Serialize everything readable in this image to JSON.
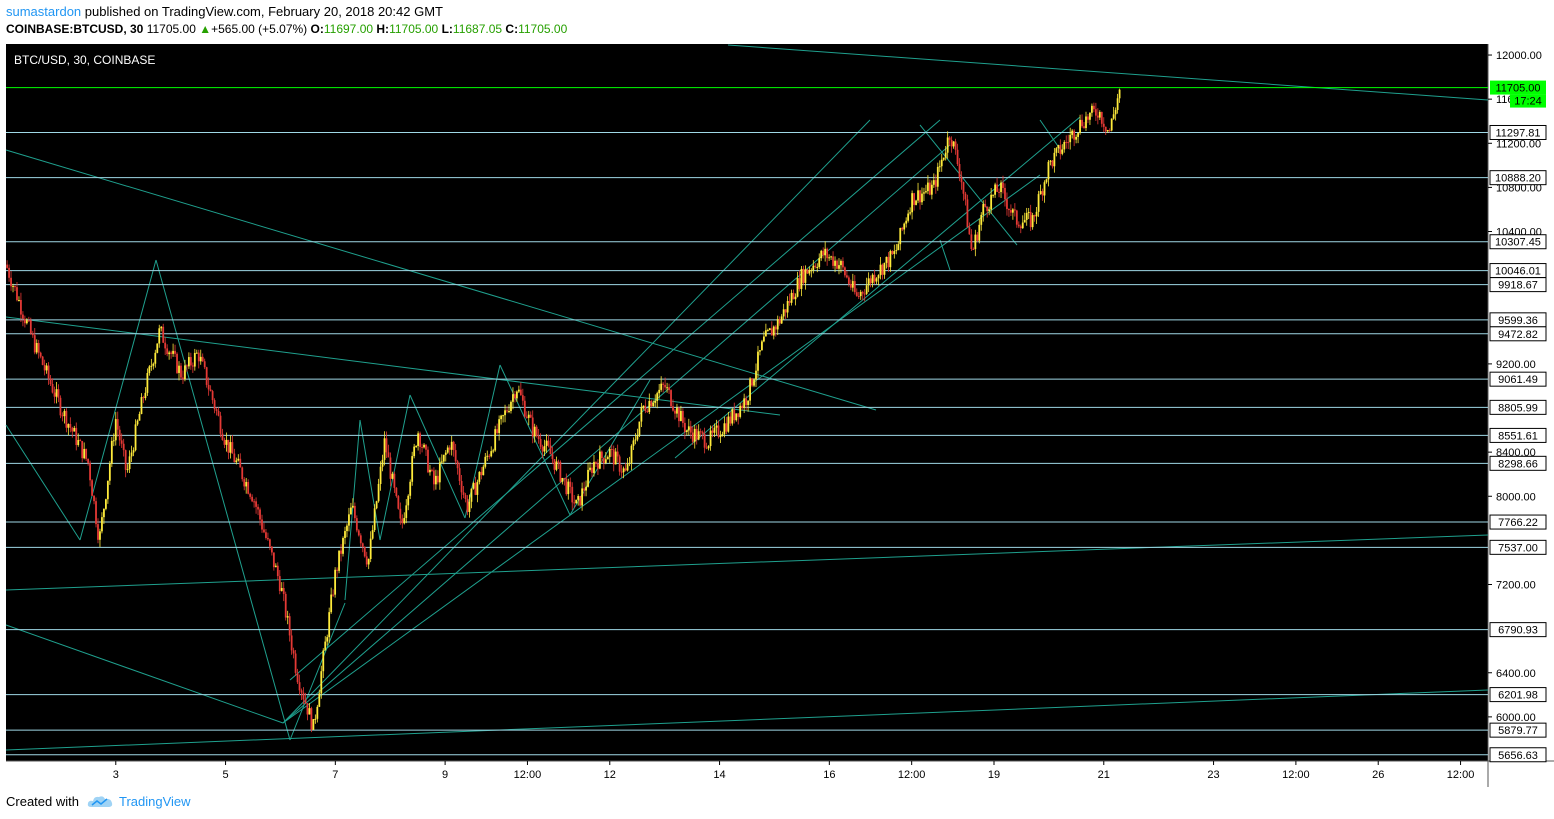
{
  "header": {
    "user": "sumastardon",
    "published_text": "published on TradingView.com, February 20, 2018 20:42 GMT",
    "symbol": "COINBASE:BTCUSD, 30",
    "last": "11705.00",
    "change": "+565.00 (+5.07%)",
    "o_label": "O:",
    "o_value": "11697.00",
    "h_label": "H:",
    "h_value": "11705.00",
    "l_label": "L:",
    "l_value": "11687.05",
    "c_label": "C:",
    "c_value": "11705.00"
  },
  "footer": {
    "created_with": "Created with",
    "brand": "TradingView"
  },
  "colors": {
    "background": "#000000",
    "level_line": "#9fd8e6",
    "trend_line": "#1fa08e",
    "last_price": "#00ff00",
    "candle_up": "#ffeb3b",
    "candle_down": "#e53935"
  },
  "chart_data": {
    "type": "candlestick",
    "title": "BTC/USD, 30, COINBASE",
    "ylim": [
      5600,
      12100
    ],
    "y_ticks": [
      12000,
      11600,
      11200,
      10800,
      10400,
      9200,
      8400,
      8000,
      7200,
      6400,
      6000
    ],
    "x_ticks": [
      "3",
      "5",
      "7",
      "9",
      "12:00",
      "12",
      "14",
      "16",
      "12:00",
      "19",
      "21",
      "23",
      "12:00",
      "26",
      "12:00"
    ],
    "x_tick_days": [
      3,
      5,
      7,
      9,
      10.5,
      12,
      14,
      16,
      17.5,
      19,
      21,
      23,
      24.5,
      26,
      27.5
    ],
    "xlim_days": [
      1.0,
      28.0
    ],
    "horizontal_levels": [
      11297.81,
      10888.2,
      10307.45,
      10046.01,
      9918.67,
      9599.36,
      9472.82,
      9061.49,
      8805.99,
      8551.61,
      8298.66,
      7766.22,
      7537.0,
      6790.93,
      6201.98,
      5879.77,
      5656.63
    ],
    "last_price": {
      "value": "11705.00",
      "timer": "17:24"
    },
    "price_path": [
      [
        1.0,
        10100
      ],
      [
        1.5,
        9400
      ],
      [
        2.0,
        8800
      ],
      [
        2.5,
        8300
      ],
      [
        2.7,
        7600
      ],
      [
        3.0,
        8700
      ],
      [
        3.2,
        8200
      ],
      [
        3.5,
        8900
      ],
      [
        3.8,
        9500
      ],
      [
        4.2,
        9100
      ],
      [
        4.5,
        9300
      ],
      [
        5.0,
        8500
      ],
      [
        5.5,
        8000
      ],
      [
        6.0,
        7200
      ],
      [
        6.3,
        6400
      ],
      [
        6.6,
        5900
      ],
      [
        6.8,
        6600
      ],
      [
        7.0,
        7300
      ],
      [
        7.3,
        7900
      ],
      [
        7.6,
        7400
      ],
      [
        7.9,
        8500
      ],
      [
        8.2,
        7700
      ],
      [
        8.5,
        8600
      ],
      [
        8.8,
        8100
      ],
      [
        9.1,
        8500
      ],
      [
        9.4,
        7900
      ],
      [
        9.8,
        8400
      ],
      [
        10.3,
        9000
      ],
      [
        10.6,
        8600
      ],
      [
        10.9,
        8400
      ],
      [
        11.4,
        7900
      ],
      [
        11.7,
        8300
      ],
      [
        12.0,
        8400
      ],
      [
        12.3,
        8200
      ],
      [
        12.6,
        8800
      ],
      [
        13.0,
        9000
      ],
      [
        13.4,
        8600
      ],
      [
        13.8,
        8500
      ],
      [
        14.2,
        8700
      ],
      [
        14.5,
        8900
      ],
      [
        14.8,
        9400
      ],
      [
        15.1,
        9600
      ],
      [
        15.5,
        10000
      ],
      [
        15.9,
        10200
      ],
      [
        16.2,
        10100
      ],
      [
        16.5,
        9800
      ],
      [
        16.8,
        10000
      ],
      [
        17.2,
        10200
      ],
      [
        17.5,
        10700
      ],
      [
        17.9,
        10800
      ],
      [
        18.2,
        11300
      ],
      [
        18.4,
        10900
      ],
      [
        18.6,
        10200
      ],
      [
        18.8,
        10600
      ],
      [
        19.1,
        10800
      ],
      [
        19.4,
        10500
      ],
      [
        19.7,
        10500
      ],
      [
        20.0,
        11000
      ],
      [
        20.3,
        11200
      ],
      [
        20.6,
        11400
      ],
      [
        20.9,
        11500
      ],
      [
        21.1,
        11300
      ],
      [
        21.3,
        11705
      ]
    ]
  }
}
